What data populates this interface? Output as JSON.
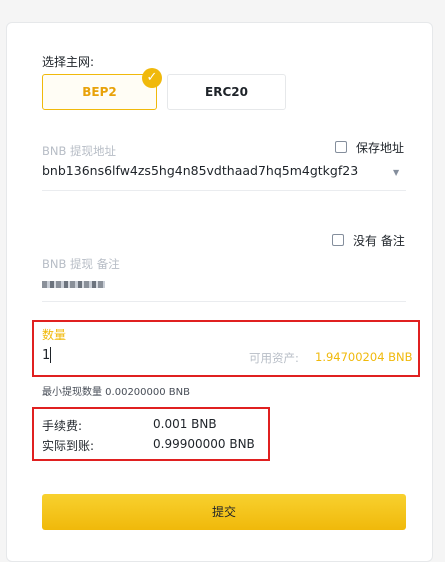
{
  "network": {
    "label": "选择主网:",
    "options": [
      {
        "label": "BEP2",
        "selected": true
      },
      {
        "label": "ERC20",
        "selected": false
      }
    ]
  },
  "address": {
    "label": "BNB 提现地址",
    "save_label": "保存地址",
    "value": "bnb136ns6lfw4zs5hg4n85vdthaad7hq5m4gtkgf23"
  },
  "memo": {
    "no_memo_label": "没有 备注",
    "label": "BNB 提现 备注"
  },
  "amount": {
    "label": "数量",
    "value": "1",
    "available_label": "可用资产:",
    "available_value": "1.94700204 BNB"
  },
  "min_withdraw": "最小提现数量 0.00200000 BNB",
  "fee": {
    "label": "手续费:",
    "value": "0.001 BNB"
  },
  "received": {
    "label": "实际到账:",
    "value": "0.99900000 BNB"
  },
  "submit_label": "提交",
  "colors": {
    "accent": "#f0b90b",
    "highlight_box": "#e02020"
  }
}
